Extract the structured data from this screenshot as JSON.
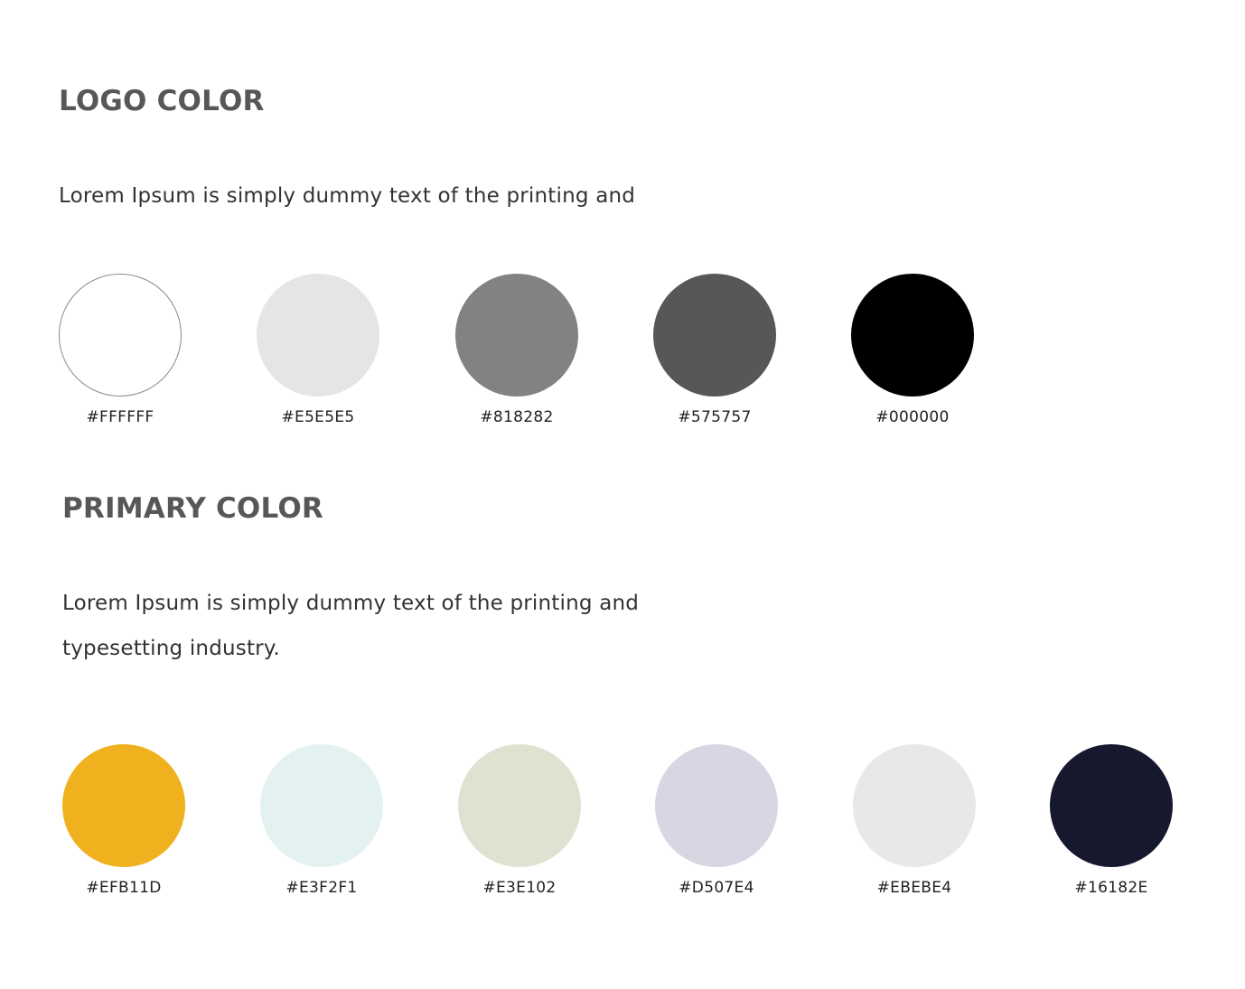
{
  "logo_section": {
    "title": "LOGO COLOR",
    "description_lines": [
      "Lorem Ipsum is simply dummy text of the printing and"
    ],
    "swatches": [
      {
        "label": "#FFFFFF",
        "color": "#FFFFFF",
        "outlined": true
      },
      {
        "label": "#E5E5E5",
        "color": "#E5E5E5"
      },
      {
        "label": "#818282",
        "color": "#818282"
      },
      {
        "label": "#575757",
        "color": "#575757"
      },
      {
        "label": "#000000",
        "color": "#000000"
      }
    ]
  },
  "primary_section": {
    "title": "PRIMARY COLOR",
    "description_lines": [
      "Lorem Ipsum is simply dummy text of the printing and",
      "typesetting industry."
    ],
    "swatches": [
      {
        "label": "#EFB11D",
        "color": "#EFB11D"
      },
      {
        "label": "#E3F2F1",
        "color": "#E3F2F1"
      },
      {
        "label": "#E3E102",
        "color": "#E1E1D2"
      },
      {
        "label": "#D507E4",
        "color": "#D7D7E4"
      },
      {
        "label": "#EBEBE4",
        "color": "#E8E8E6"
      },
      {
        "label": "#16182E",
        "color": "#16182E"
      }
    ]
  }
}
